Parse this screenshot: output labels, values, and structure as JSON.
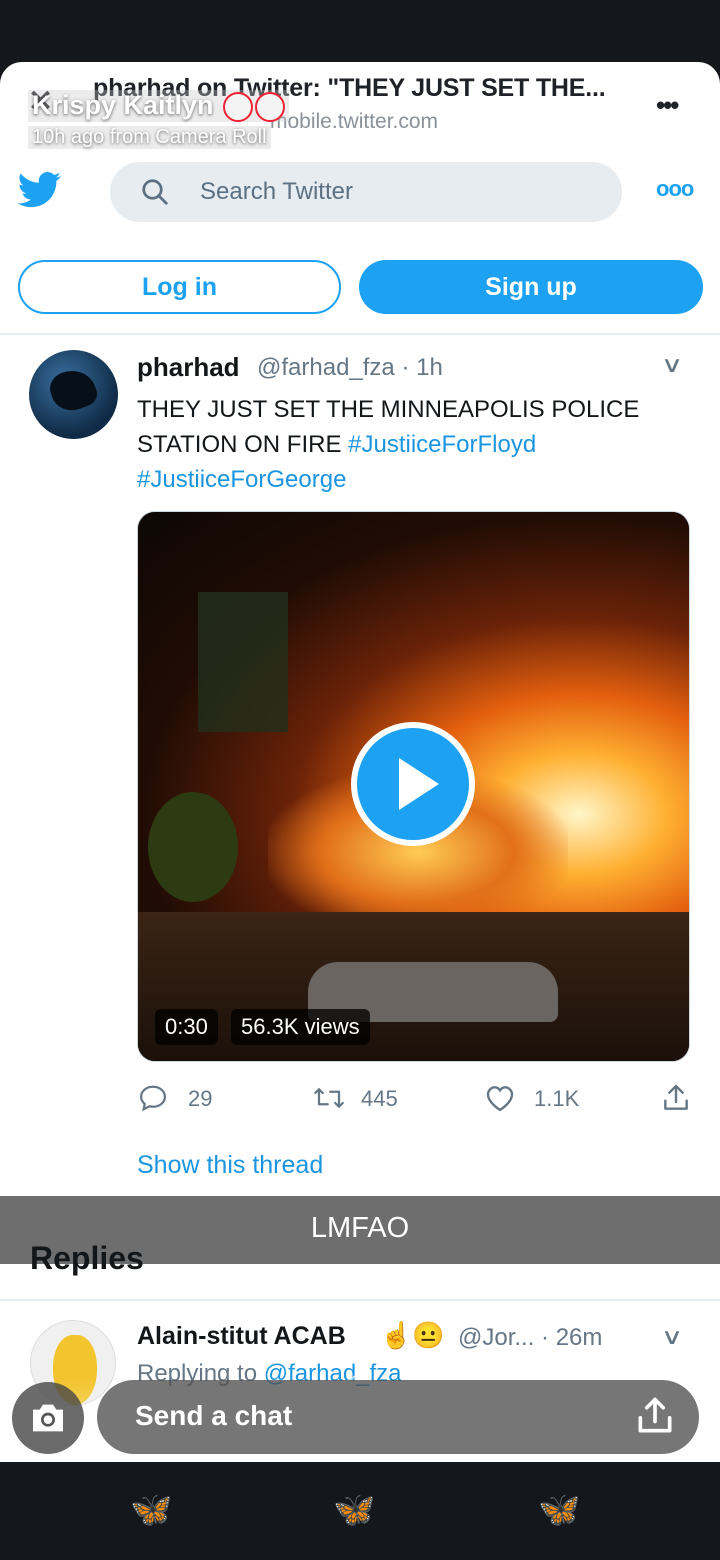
{
  "browser": {
    "title": "pharhad on Twitter: \"THEY JUST SET THE...",
    "url": "mobile.twitter.com",
    "more": "•••"
  },
  "snap": {
    "name": "Krispy Kaitlyn",
    "time": "10h ago from Camera Roll",
    "caption": "LMFAO",
    "chat_placeholder": "Send a chat"
  },
  "twitter": {
    "search_placeholder": "Search Twitter",
    "more": "ooo",
    "login_label": "Log in",
    "signup_label": "Sign up"
  },
  "tweet": {
    "author": "pharhad",
    "handle": "@farhad_fza · 1h",
    "text_plain": "THEY JUST SET THE MINNEAPOLIS POLICE STATION ON FIRE ",
    "tag1": "#JustiiceForFloyd",
    "tag2": "#JustiiceForGeorge",
    "duration": "0:30",
    "views": "56.3K views",
    "replies": "29",
    "retweets": "445",
    "likes": "1.1K",
    "show_thread": "Show this thread"
  },
  "replies_heading": "Replies",
  "reply": {
    "author": "Alain-stitut ACAB",
    "emoji": "☝😐",
    "handle": "@Jor... · 26m",
    "replying_prefix": "Replying to ",
    "replying_to": "@farhad_fza"
  },
  "colors": {
    "twitter_blue": "#1da1f2",
    "link_blue": "#1b95e0",
    "dark_bg": "#14171c"
  }
}
